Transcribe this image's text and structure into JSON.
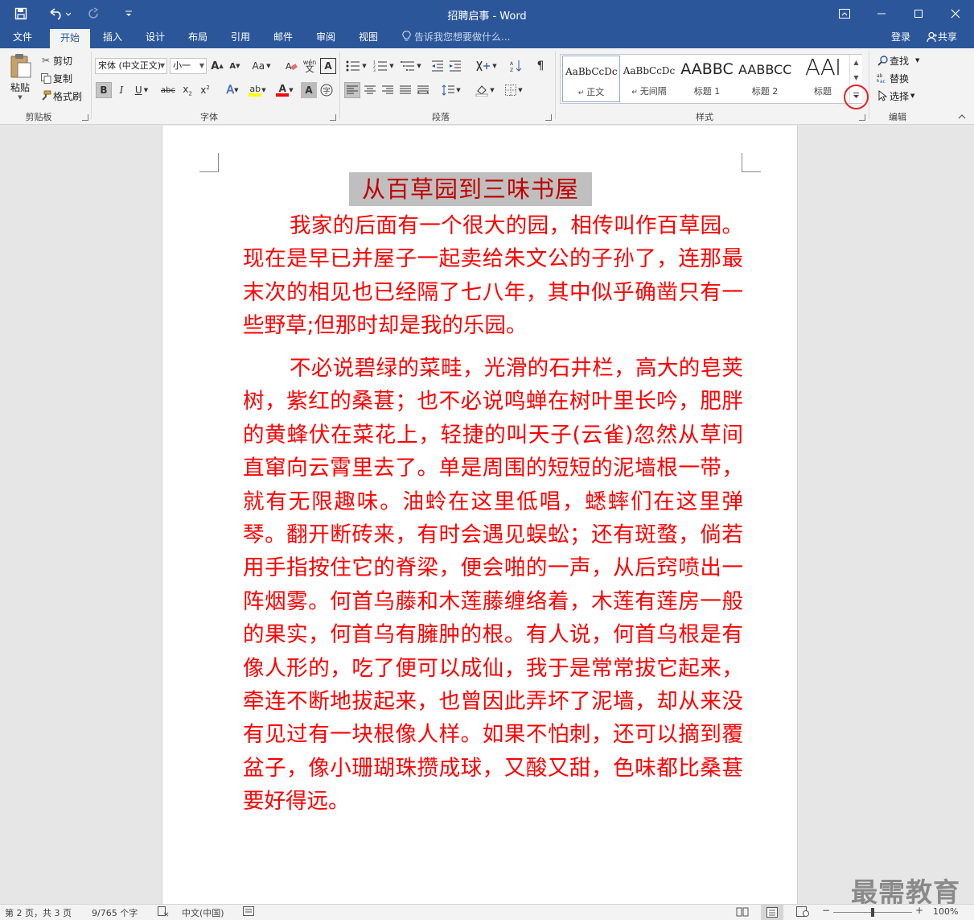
{
  "titlebar": {
    "title": "招聘启事 - Word",
    "qat": {
      "save": "save-icon",
      "undo": "undo-icon",
      "redo": "redo-icon",
      "customize": "customize-icon"
    },
    "window": {
      "ribbon_display": "ribbon-display-icon",
      "minimize": "minimize-icon",
      "maximize": "maximize-icon",
      "close": "close-icon"
    }
  },
  "tabs": [
    {
      "label": "文件"
    },
    {
      "label": "开始"
    },
    {
      "label": "插入"
    },
    {
      "label": "设计"
    },
    {
      "label": "布局"
    },
    {
      "label": "引用"
    },
    {
      "label": "邮件"
    },
    {
      "label": "审阅"
    },
    {
      "label": "视图"
    }
  ],
  "tellme": {
    "placeholder": "告诉我您想要做什么..."
  },
  "account": {
    "login": "登录",
    "share": "共享"
  },
  "clipboard": {
    "paste": "粘贴",
    "cut": "剪切",
    "copy": "复制",
    "format_painter": "格式刷",
    "label": "剪贴板"
  },
  "font": {
    "name": "宋体 (中文正文)",
    "size": "小一",
    "label": "字体"
  },
  "paragraph": {
    "label": "段落"
  },
  "styles": {
    "label": "样式",
    "items": [
      {
        "preview": "AaBbCcDc",
        "name": "正文"
      },
      {
        "preview": "AaBbCcDc",
        "name": "无间隔"
      },
      {
        "preview": "AABBC",
        "name": "标题 1"
      },
      {
        "preview": "AABBCC",
        "name": "标题 2"
      },
      {
        "preview": "AAI",
        "name": "标题"
      }
    ]
  },
  "editing": {
    "find": "查找",
    "replace": "替换",
    "select": "选择",
    "label": "编辑"
  },
  "document": {
    "title": "从百草园到三味书屋",
    "paragraphs": [
      "我家的后面有一个很大的园，相传叫作百草园。现在是早已并屋子一起卖给朱文公的子孙了，连那最末次的相见也已经隔了七八年，其中似乎确凿只有一些野草;但那时却是我的乐园。",
      "不必说碧绿的菜畦，光滑的石井栏，高大的皂荚树，紫红的桑葚；也不必说鸣蝉在树叶里长吟，肥胖的黄蜂伏在菜花上，轻捷的叫天子(云雀)忽然从草间直窜向云霄里去了。单是周围的短短的泥墙根一带，就有无限趣味。油蛉在这里低唱，蟋蟀们在这里弹琴。翻开断砖来，有时会遇见蜈蚣；还有斑蝥，倘若用手指按住它的脊梁，便会啪的一声，从后窍喷出一阵烟雾。何首乌藤和木莲藤缠络着，木莲有莲房一般的果实，何首乌有臃肿的根。有人说，何首乌根是有像人形的，吃了便可以成仙，我于是常常拔它起来，牵连不断地拔起来，也曾因此弄坏了泥墙，却从来没有见过有一块根像人样。如果不怕刺，还可以摘到覆盆子，像小珊瑚珠攒成球，又酸又甜，色味都比桑葚要好得远。"
    ]
  },
  "statusbar": {
    "page": "第 2 页，共 3 页",
    "words": "9/765 个字",
    "language": "中文(中国)",
    "zoom": "100%",
    "zoom_fraction": 0.5
  },
  "watermark": "最需教育",
  "colors": {
    "accent": "#2b579a",
    "text_red": "#ff0000",
    "title_red": "#c00000",
    "highlight_circle": "#e3242b"
  }
}
